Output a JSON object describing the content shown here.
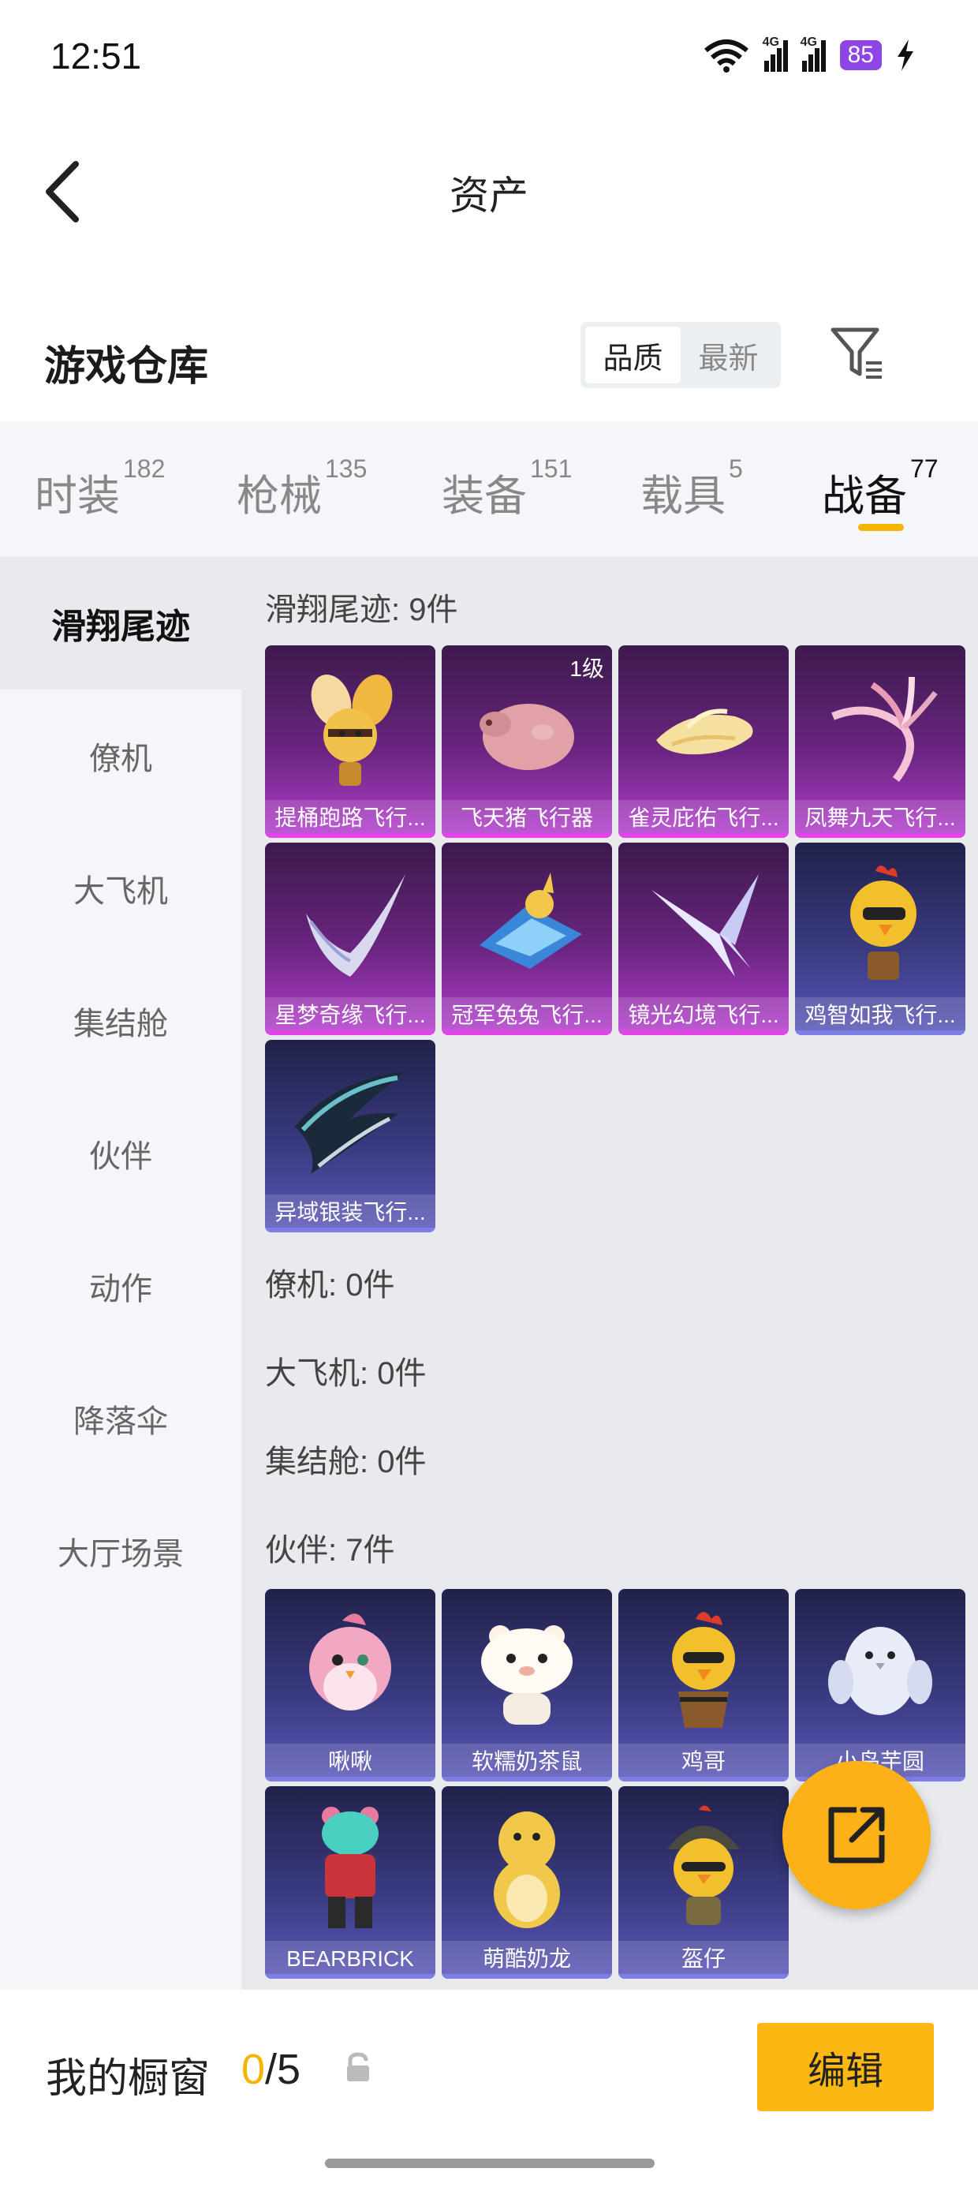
{
  "status": {
    "time": "12:51",
    "network1": "4G",
    "network2": "4G",
    "battery": "85"
  },
  "header": {
    "title": "资产"
  },
  "section": {
    "title": "游戏仓库"
  },
  "sort": {
    "options": [
      "品质",
      "最新"
    ],
    "selected": "品质"
  },
  "tabs": [
    {
      "label": "时装",
      "count": "182"
    },
    {
      "label": "枪械",
      "count": "135"
    },
    {
      "label": "装备",
      "count": "151"
    },
    {
      "label": "载具",
      "count": "5"
    },
    {
      "label": "战备",
      "count": "77",
      "active": true
    }
  ],
  "sidebar": {
    "items": [
      "滑翔尾迹",
      "僚机",
      "大飞机",
      "集结舱",
      "伙伴",
      "动作",
      "降落伞",
      "大厅场景"
    ],
    "active": "滑翔尾迹"
  },
  "content": {
    "groups": [
      {
        "title": "滑翔尾迹: 9件",
        "items": [
          {
            "name": "提桶跑路飞行...",
            "level": "",
            "rarity": "purple",
            "icon": "bee-balloon-icon"
          },
          {
            "name": "飞天猪飞行器",
            "level": "1级",
            "rarity": "purple",
            "icon": "flying-pig-icon"
          },
          {
            "name": "雀灵庇佑飞行...",
            "level": "",
            "rarity": "purple",
            "icon": "golden-bird-icon"
          },
          {
            "name": "凤舞九天飞行...",
            "level": "",
            "rarity": "purple",
            "icon": "phoenix-icon"
          },
          {
            "name": "星梦奇缘飞行...",
            "level": "",
            "rarity": "purple",
            "icon": "feather-wing-icon"
          },
          {
            "name": "冠军兔兔飞行...",
            "level": "",
            "rarity": "purple",
            "icon": "rabbit-jet-icon"
          },
          {
            "name": "镜光幻境飞行...",
            "level": "",
            "rarity": "purple",
            "icon": "crystal-wing-icon"
          },
          {
            "name": "鸡智如我飞行...",
            "level": "",
            "rarity": "blue",
            "icon": "chicken-icon"
          },
          {
            "name": "异域银装飞行...",
            "level": "",
            "rarity": "blue",
            "icon": "silver-blade-icon"
          }
        ]
      },
      {
        "title": "僚机: 0件",
        "items": []
      },
      {
        "title": "大飞机: 0件",
        "items": []
      },
      {
        "title": "集结舱: 0件",
        "items": []
      },
      {
        "title": "伙伴: 7件",
        "items": [
          {
            "name": "啾啾",
            "rarity": "blue",
            "icon": "pink-bird-icon"
          },
          {
            "name": "软糯奶茶鼠",
            "rarity": "blue",
            "icon": "hamster-icon"
          },
          {
            "name": "鸡哥",
            "rarity": "blue",
            "icon": "rooster-icon"
          },
          {
            "name": "小鸟芋圆",
            "rarity": "blue",
            "icon": "white-bird-icon"
          },
          {
            "name": "BEARBRICK",
            "rarity": "blue",
            "icon": "bearbrick-icon"
          },
          {
            "name": "萌酷奶龙",
            "rarity": "blue",
            "icon": "yellow-dino-icon"
          },
          {
            "name": "盔仔",
            "rarity": "blue",
            "icon": "helmet-chick-icon"
          }
        ]
      }
    ]
  },
  "showcase": {
    "label": "我的橱窗",
    "current": "0",
    "max": "/5",
    "edit_label": "编辑"
  },
  "colors": {
    "accent": "#f5b400",
    "purple_card": "#b53ecf",
    "blue_card": "#5a56b8",
    "sidebar_bg": "#f4f6f9",
    "content_bg": "#e8eaee"
  }
}
